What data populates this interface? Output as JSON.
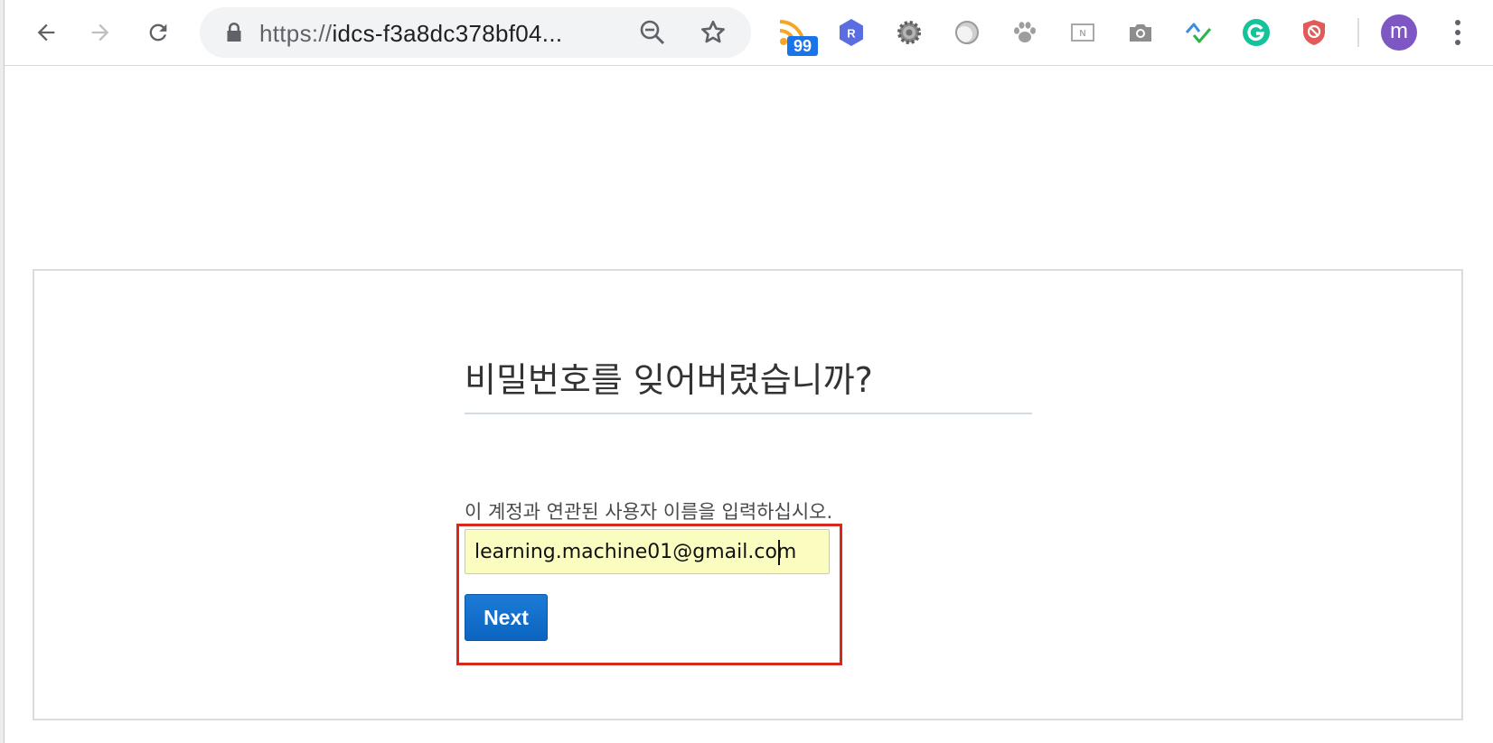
{
  "browser": {
    "url_scheme": "https://",
    "url_host": "idcs-f3a8dc378bf04...",
    "rss_badge": "99",
    "profile_initial": "m",
    "icons": {
      "back": "arrow-left-icon",
      "forward": "arrow-right-icon",
      "reload": "reload-icon",
      "lock": "lock-icon",
      "zoom": "zoom-out-icon",
      "bookmark": "star-icon",
      "menu": "more-vert-icon"
    },
    "extensions": [
      "rss-feed-icon",
      "r-hexagon-icon",
      "gear-icon",
      "circle-icon",
      "paw-icon",
      "notion-icon",
      "camera-icon",
      "check-zigzag-icon",
      "grammarly-icon",
      "shield-block-icon"
    ]
  },
  "page": {
    "heading": "비밀번호를 잊어버렸습니까?",
    "prompt": "이 계정과 연관된 사용자 이름을 입력하십시오.",
    "username_value": "learning.machine01@gmail.com",
    "next_label": "Next"
  },
  "colors": {
    "accent": "#0f6ecb",
    "highlight_border": "#d9271c",
    "autofill_bg": "#fbfdc0",
    "avatar": "#7e57c2"
  }
}
